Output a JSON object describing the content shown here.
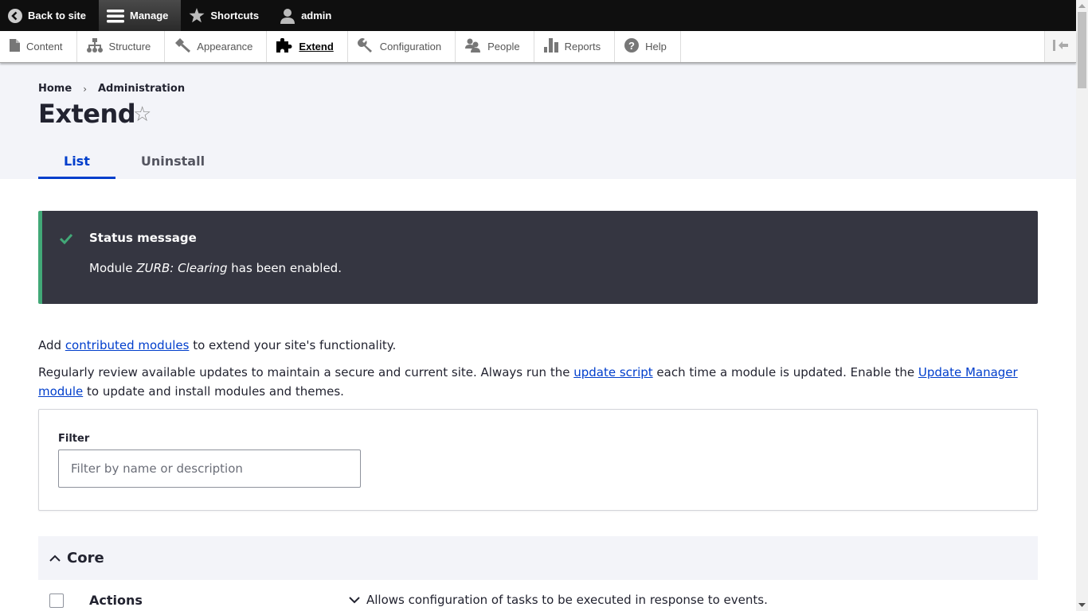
{
  "toolbar": {
    "items": [
      {
        "label": "Back to site",
        "icon": "back-circle-icon"
      },
      {
        "label": "Manage",
        "icon": "hamburger-icon"
      },
      {
        "label": "Shortcuts",
        "icon": "star-icon"
      },
      {
        "label": "admin",
        "icon": "user-icon"
      }
    ]
  },
  "tray": {
    "items": [
      {
        "label": "Content",
        "icon": "file-icon"
      },
      {
        "label": "Structure",
        "icon": "sitemap-icon"
      },
      {
        "label": "Appearance",
        "icon": "paintbrush-icon"
      },
      {
        "label": "Extend",
        "icon": "puzzle-icon",
        "active": true
      },
      {
        "label": "Configuration",
        "icon": "wrench-icon"
      },
      {
        "label": "People",
        "icon": "people-icon"
      },
      {
        "label": "Reports",
        "icon": "bar-chart-icon"
      },
      {
        "label": "Help",
        "icon": "help-icon"
      }
    ],
    "orientation_toggle_icon": "collapse-left-icon"
  },
  "breadcrumb": [
    "Home",
    "Administration"
  ],
  "breadcrumb_separator": "›",
  "page_title": "Extend",
  "tabs": [
    {
      "label": "List",
      "active": true
    },
    {
      "label": "Uninstall",
      "active": false
    }
  ],
  "status_message": {
    "title": "Status message",
    "prefix": "Module ",
    "module": "ZURB: Clearing",
    "suffix": " has been enabled.",
    "accent_color": "#42a877"
  },
  "intro": {
    "line1_before": "Add ",
    "line1_link": "contributed modules",
    "line1_after": " to extend your site's functionality.",
    "line2_before": "Regularly review available updates to maintain a secure and current site. Always run the ",
    "line2_link1": "update script",
    "line2_middle": " each time a module is updated. Enable the ",
    "line2_link2": "Update Manager module",
    "line2_after": " to update and install modules and themes."
  },
  "filter": {
    "label": "Filter",
    "placeholder": "Filter by name or description",
    "value": ""
  },
  "core": {
    "title": "Core",
    "modules": [
      {
        "name": "Actions",
        "description": "Allows configuration of tasks to be executed in response to events.",
        "enabled": false
      }
    ]
  },
  "colors": {
    "link": "#003ecc",
    "status_bg": "#353641",
    "header_bg": "#f3f4f9"
  }
}
